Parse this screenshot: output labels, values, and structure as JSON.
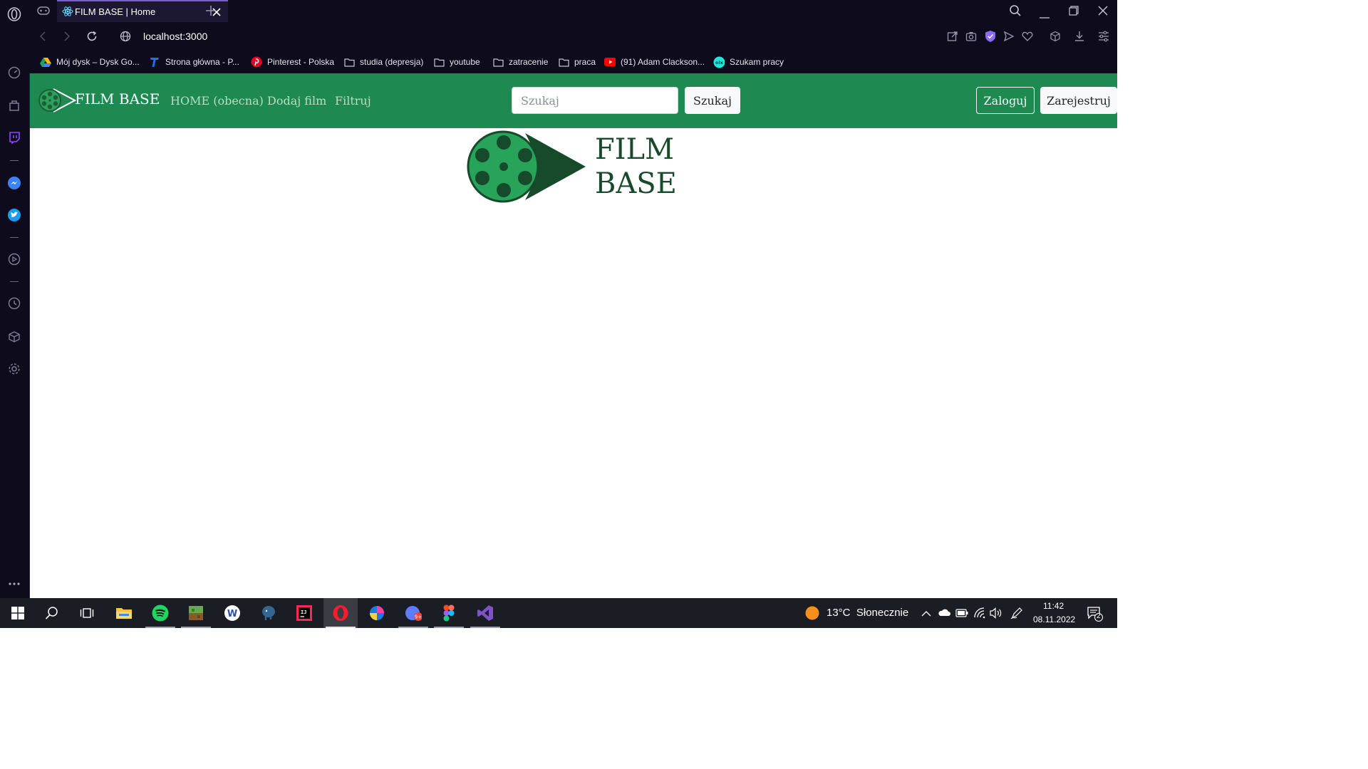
{
  "browser": {
    "tab_title": "FILM BASE | Home",
    "url": "localhost:3000",
    "bookmarks": [
      {
        "label": "Mój dysk – Dysk Go...",
        "icon": "google-drive-icon"
      },
      {
        "label": "Strona główna - P...",
        "icon": "t-logo-icon"
      },
      {
        "label": "Pinterest - Polska",
        "icon": "pinterest-icon"
      },
      {
        "label": "studia (depresja)",
        "icon": "folder-icon"
      },
      {
        "label": "youtube",
        "icon": "folder-icon"
      },
      {
        "label": "zatracenie",
        "icon": "folder-icon"
      },
      {
        "label": "praca",
        "icon": "folder-icon"
      },
      {
        "label": "(91) Adam Clackson...",
        "icon": "youtube-icon"
      },
      {
        "label": "Szukam pracy",
        "icon": "olx-icon"
      }
    ]
  },
  "site": {
    "brand": "FILM BASE",
    "nav": {
      "home": "HOME (obecna)",
      "add": "Dodaj film",
      "filter": "Filtruj"
    },
    "search": {
      "placeholder": "Szukaj",
      "value": "",
      "button": "Szukaj"
    },
    "auth": {
      "login": "Zaloguj",
      "register": "Zarejestruj"
    },
    "hero": {
      "line1": "FILM",
      "line2": "BASE"
    }
  },
  "taskbar": {
    "weather": "13°C  Słonecznie",
    "time": "11:42",
    "date": "08.11.2022",
    "notifications": "2"
  },
  "colors": {
    "navbar": "#1e8a52",
    "browser_chrome": "#0e0b1d",
    "accent": "#7a5fdc",
    "logo_dark": "#174a2b",
    "logo_light": "#27a35a"
  }
}
